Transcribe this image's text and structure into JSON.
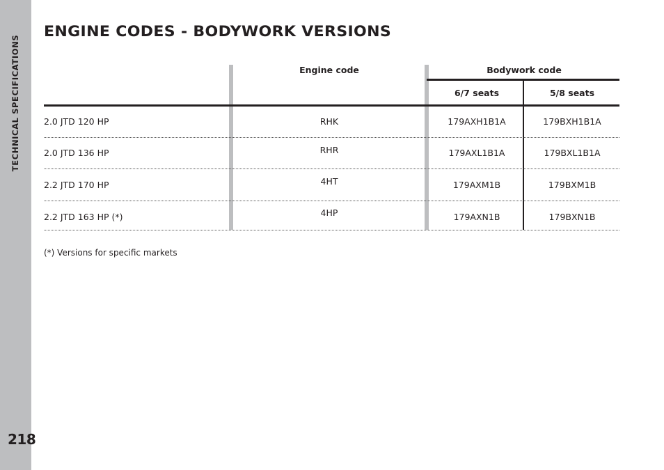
{
  "sidebar": {
    "section_title": "TECHNICAL SPECIFICATIONS",
    "page_number": "218"
  },
  "page": {
    "title": "ENGINE CODES - BODYWORK VERSIONS"
  },
  "table": {
    "headers": {
      "engine_code": "Engine code",
      "bodywork_code": "Bodywork code",
      "seats_a": "6/7 seats",
      "seats_b": "5/8 seats"
    },
    "rows": [
      {
        "version": "2.0 JTD 120 HP",
        "engine_code": "RHK",
        "bodywork_67": "179AXH1B1A",
        "bodywork_58": "179BXH1B1A"
      },
      {
        "version": "2.0 JTD 136 HP",
        "engine_code": "RHR",
        "bodywork_67": "179AXL1B1A",
        "bodywork_58": "179BXL1B1A"
      },
      {
        "version": "2.2 JTD 170 HP",
        "engine_code": "4HT",
        "bodywork_67": "179AXM1B",
        "bodywork_58": "179BXM1B"
      },
      {
        "version": "2.2 JTD 163 HP (*)",
        "engine_code": "4HP",
        "bodywork_67": "179AXN1B",
        "bodywork_58": "179BXN1B"
      }
    ]
  },
  "footnote": "(*) Versions for specific markets"
}
